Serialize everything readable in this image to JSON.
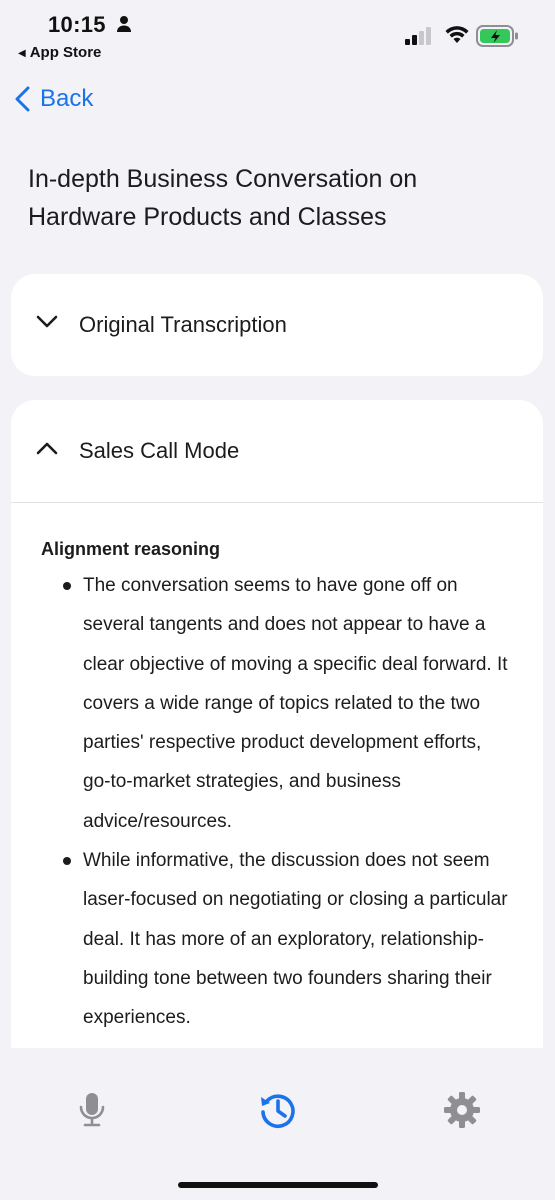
{
  "status_bar": {
    "time": "10:15",
    "back_to_app": "App Store",
    "icons": [
      "person-icon",
      "signal-icon",
      "wifi-icon",
      "battery-charging-icon"
    ]
  },
  "nav": {
    "back_label": "Back"
  },
  "page": {
    "title": "In-depth Business Conversation on Hardware Products and Classes"
  },
  "sections": {
    "original": {
      "title": "Original Transcription",
      "expanded": false
    },
    "sales": {
      "title": "Sales Call Mode",
      "expanded": true,
      "heading": "Alignment reasoning",
      "bullets": [
        "The conversation seems to have gone off on several tangents and does not appear to have a clear objective of moving a specific deal forward. It covers a wide range of topics related to the two parties' respective product development efforts, go-to-market strategies, and business advice/resources.",
        "While informative, the discussion does not seem laser-focused on negotiating or closing a particular deal. It has more of an exploratory, relationship-building tone between two founders sharing their experiences."
      ]
    }
  },
  "tab_bar": {
    "tabs": [
      {
        "name": "microphone-icon",
        "active": false
      },
      {
        "name": "history-icon",
        "active": true
      },
      {
        "name": "gear-icon",
        "active": false
      }
    ]
  },
  "colors": {
    "accent": "#1a73e8",
    "background": "#f2f2f7",
    "card": "#ffffff",
    "inactive_icon": "#8e8e93",
    "battery_fill": "#34c759"
  }
}
